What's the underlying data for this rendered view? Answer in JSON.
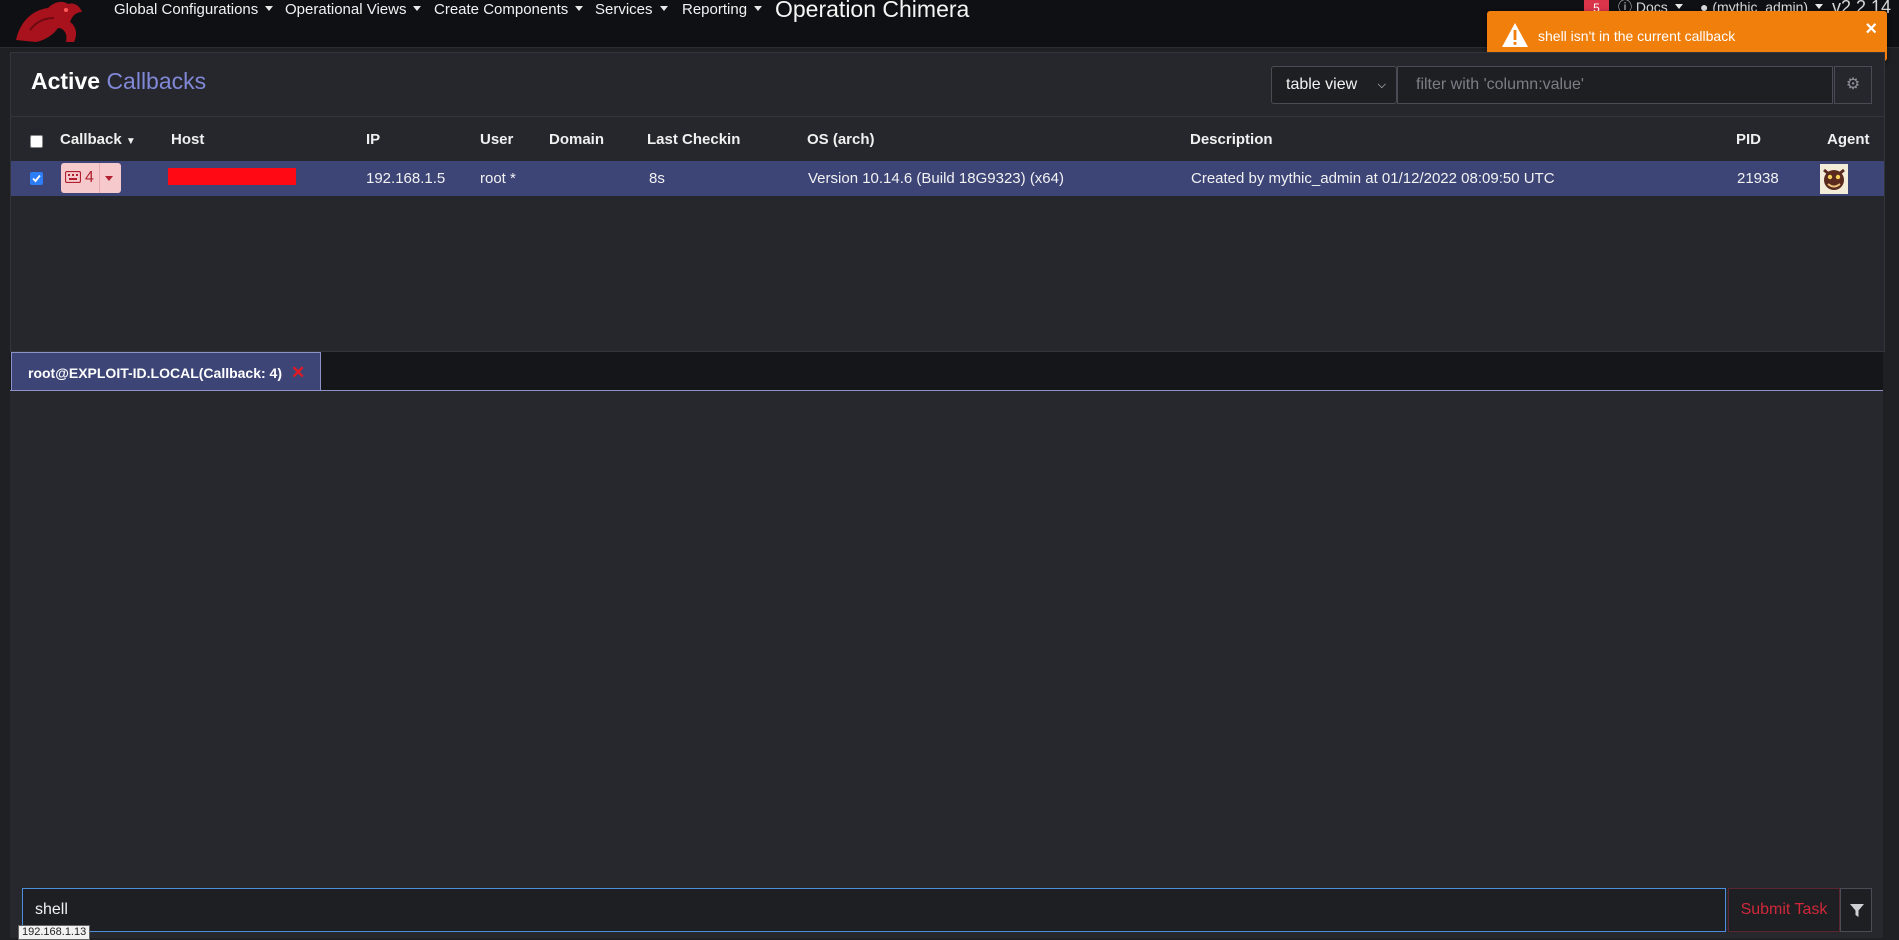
{
  "navbar": {
    "logo_icon": "mythic-logo-icon",
    "menus": [
      {
        "label": "Global Configurations"
      },
      {
        "label": "Operational Views"
      },
      {
        "label": "Create Components"
      },
      {
        "label": "Services"
      },
      {
        "label": "Reporting"
      }
    ],
    "operation_title": "Operation Chimera",
    "event_badge_count": "5",
    "docs_label": "Docs",
    "user_label": "(mythic_admin)",
    "version": "v2.2.14"
  },
  "alert": {
    "type": "warning",
    "icon": "warning-triangle-icon",
    "message": "shell isn't in the current callback",
    "close": "×",
    "color": "#f07f0c"
  },
  "callbacks_panel": {
    "title_main": "Active",
    "title_accent": "Callbacks",
    "view_select_value": "table view",
    "filter_placeholder": "filter with 'column:value'",
    "settings_icon": "gear-icon",
    "columns": [
      "Callback",
      "Host",
      "IP",
      "User",
      "Domain",
      "Last Checkin",
      "OS (arch)",
      "Description",
      "PID",
      "Agent"
    ],
    "rows": [
      {
        "selected": true,
        "callback_id": "4",
        "host": "",
        "host_redacted": true,
        "ip": "192.168.1.5",
        "user": "root *",
        "domain": "",
        "last_checkin": "8s",
        "os": "Version 10.14.6 (Build 18G9323) (x64)",
        "description": "Created by mythic_admin at 01/12/2022 08:09:50 UTC",
        "pid": "21938",
        "agent_icon": "agent-icon"
      }
    ]
  },
  "tabs": [
    {
      "label": "root@EXPLOIT-ID.LOCAL(Callback: 4)",
      "active": true,
      "close": "✕"
    }
  ],
  "task_input": {
    "value": "shell",
    "submit_label": "Submit Task",
    "filter_icon": "filter-icon"
  },
  "tooltip": {
    "text": "192.168.1.13"
  },
  "colors": {
    "selected_row": "#3d4577",
    "accent": "#8188d8",
    "danger": "#d0283a",
    "warning": "#f07f0c"
  }
}
